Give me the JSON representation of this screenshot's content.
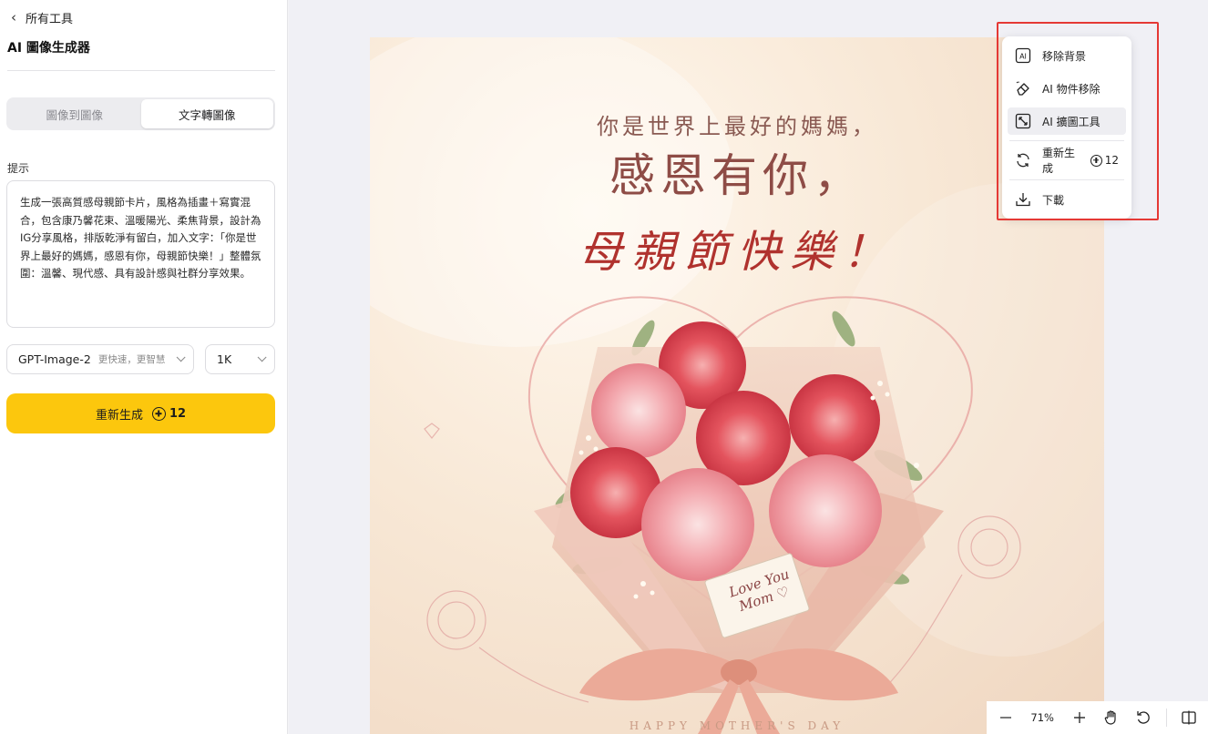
{
  "sidebar": {
    "back_label": "所有工具",
    "title": "AI 圖像生成器",
    "tabs": [
      {
        "label": "圖像到圖像",
        "active": false
      },
      {
        "label": "文字轉圖像",
        "active": true
      }
    ],
    "prompt_label": "提示",
    "prompt_text": "生成一張高質感母親節卡片，風格為插畫＋寫實混合，包含康乃馨花束、溫暖陽光、柔焦背景，設計為IG分享風格，排版乾淨有留白，加入文字：「你是世界上最好的媽媽，感恩有你，母親節快樂！」整體氛圍：溫馨、現代感、具有設計感與社群分享效果。",
    "model_select": {
      "value": "GPT-Image-2",
      "sub": "更快速，更智慧"
    },
    "resolution_select": {
      "value": "1K"
    },
    "regenerate_button": {
      "label": "重新生成",
      "credits": "12"
    }
  },
  "card": {
    "line1": "你是世界上最好的媽媽，",
    "line2": "感恩有你，",
    "line3": "母親節快樂！",
    "tag_line1": "Love You",
    "tag_line2": "Mom ♡",
    "footer": "HAPPY MOTHER'S DAY"
  },
  "menu": {
    "items": [
      {
        "label": "移除背景",
        "icon": "ai-box-icon"
      },
      {
        "label": "AI 物件移除",
        "icon": "eraser-icon"
      },
      {
        "label": "AI 擴圖工具",
        "icon": "expand-icon"
      },
      {
        "label": "重新生成",
        "icon": "refresh-icon",
        "credits": "12"
      },
      {
        "label": "下載",
        "icon": "download-icon"
      }
    ],
    "highlight_color": "#e53935"
  },
  "zoom": {
    "level": "71%"
  },
  "colors": {
    "accent": "#fcc70d",
    "highlight": "#e53935"
  }
}
